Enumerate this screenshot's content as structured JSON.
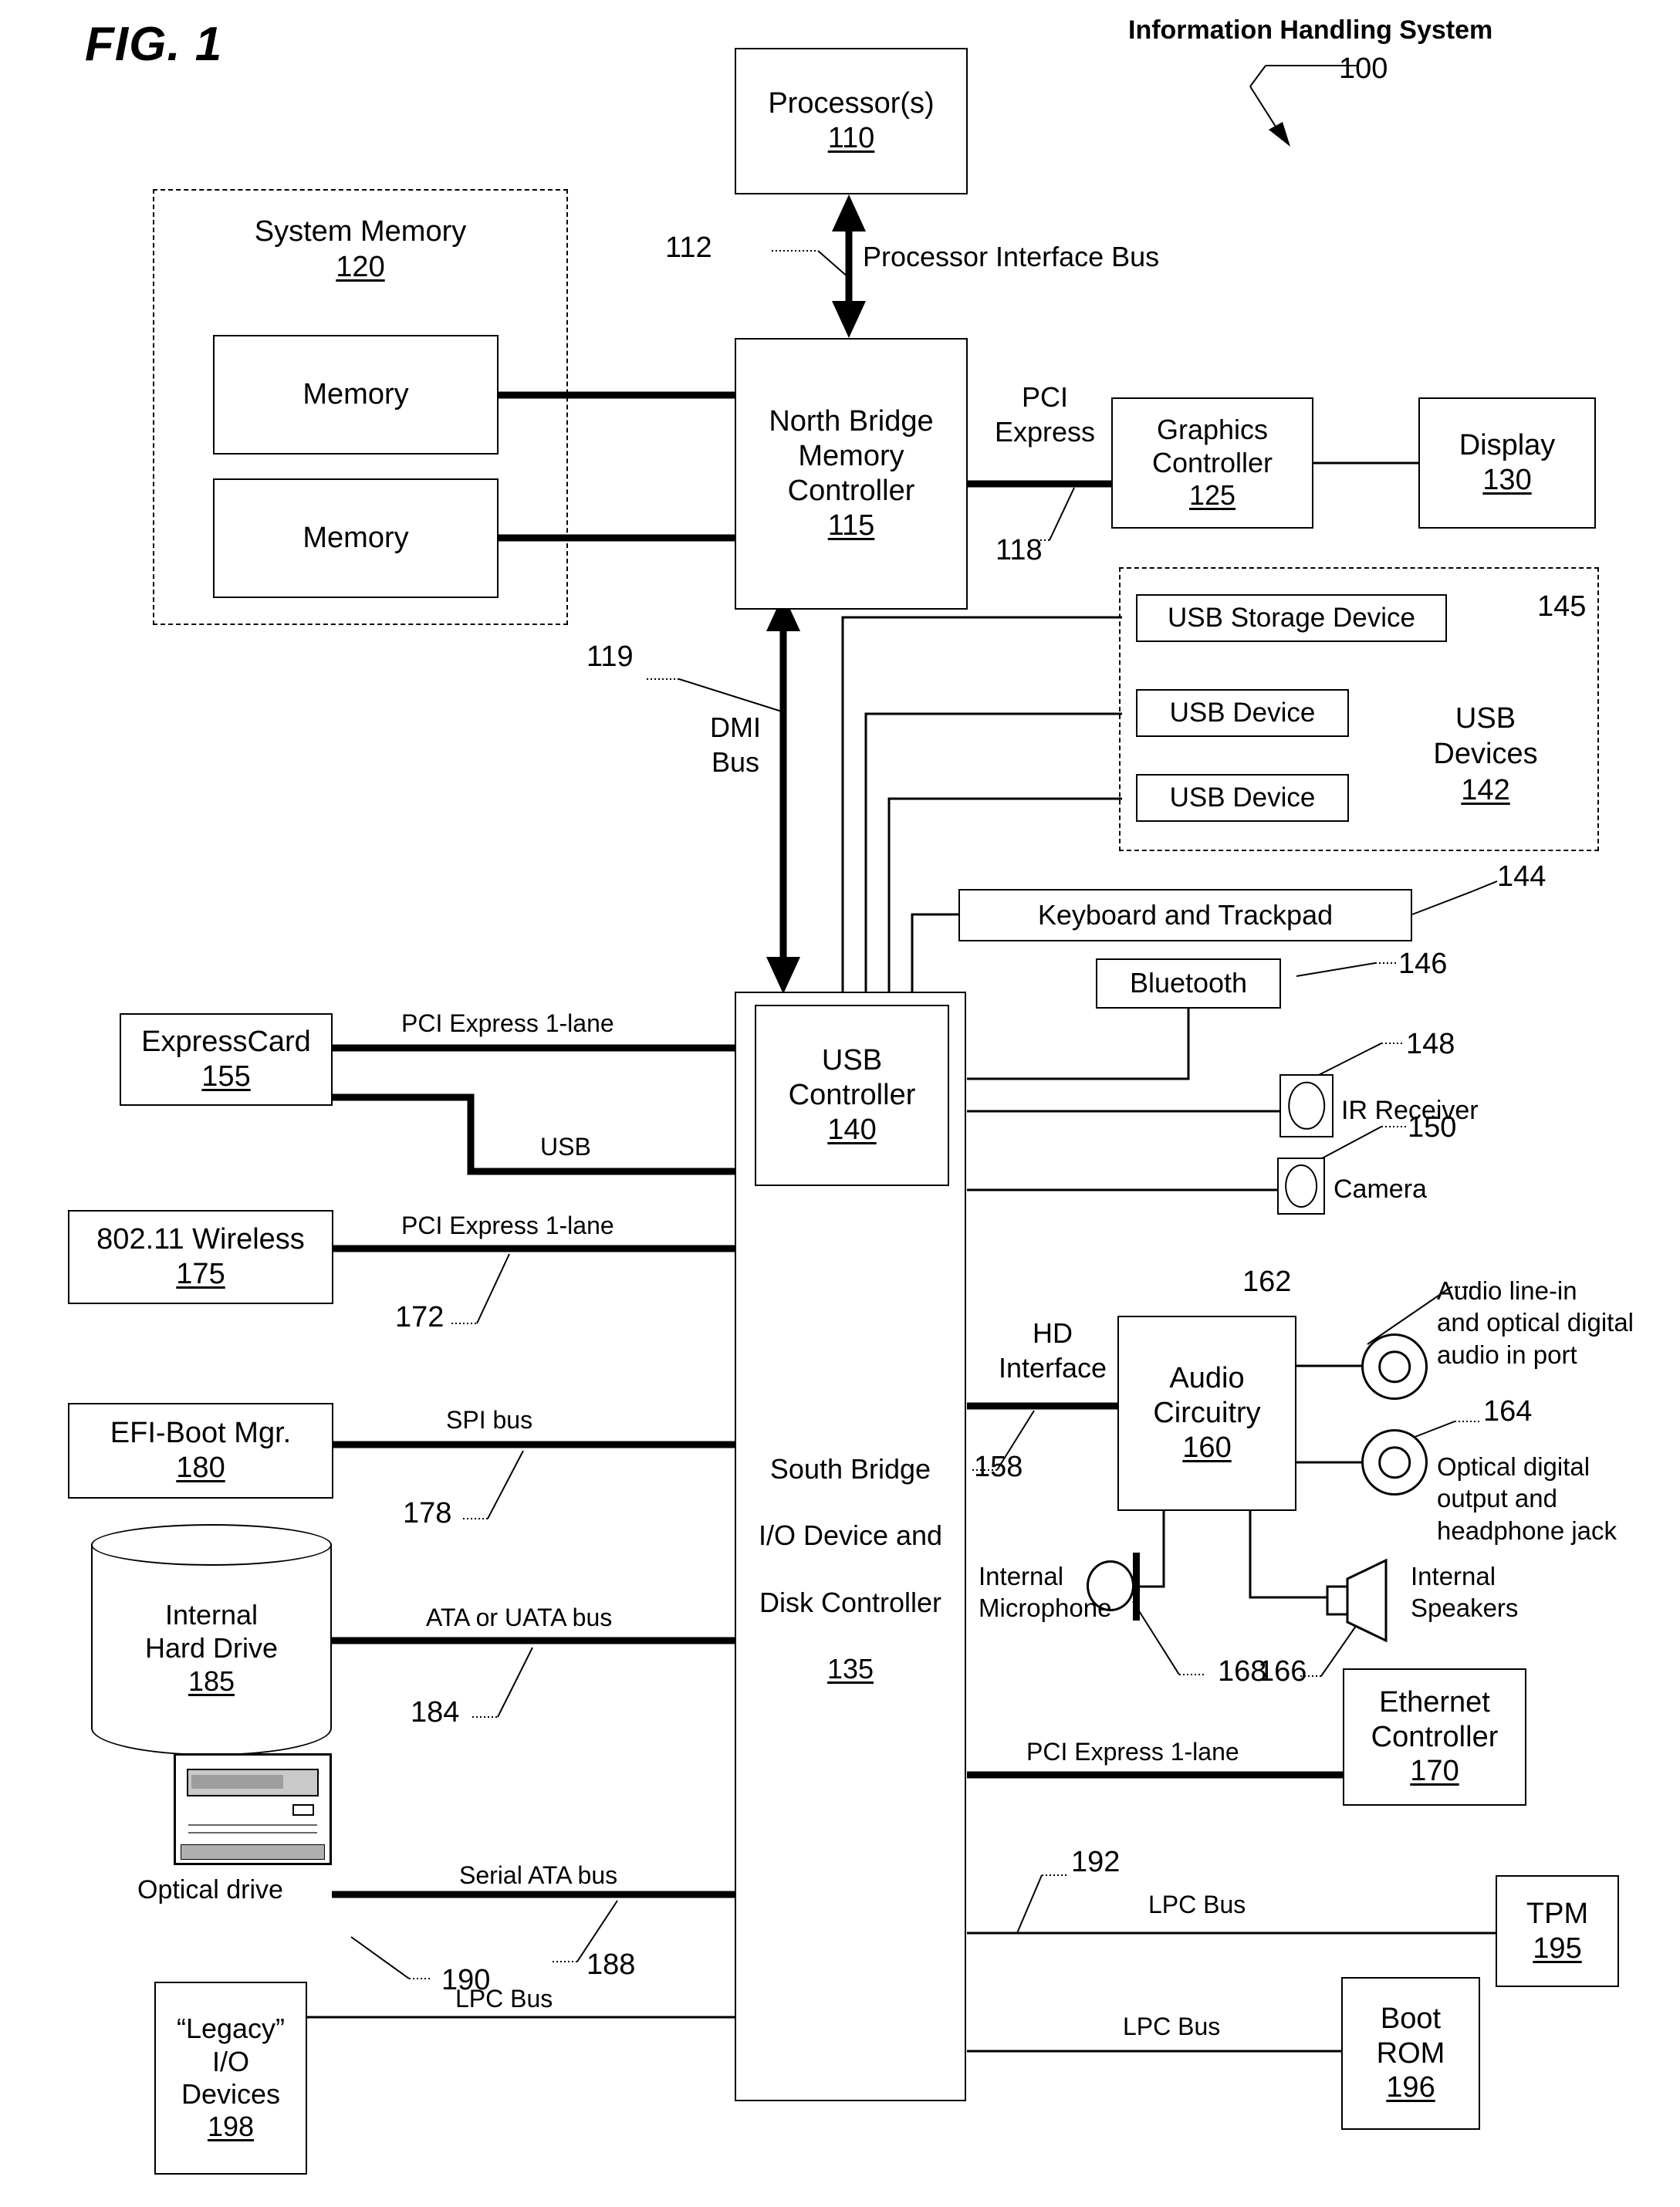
{
  "figure": {
    "title": "FIG. 1",
    "system_title": "Information Handling System",
    "system_ref": "100"
  },
  "blocks": {
    "processor": {
      "lines": [
        "Processor(s)"
      ],
      "num": "110"
    },
    "system_memory": {
      "lines": [
        "System Memory"
      ],
      "num": "120"
    },
    "memory_1": {
      "lines": [
        "Memory"
      ],
      "num": ""
    },
    "memory_2": {
      "lines": [
        "Memory"
      ],
      "num": ""
    },
    "north_bridge": {
      "lines": [
        "North Bridge",
        "Memory",
        "Controller"
      ],
      "num": "115"
    },
    "graphics": {
      "lines": [
        "Graphics",
        "Controller"
      ],
      "num": "125"
    },
    "display": {
      "lines": [
        "Display"
      ],
      "num": "130"
    },
    "usb_devices": {
      "lines": [
        "USB",
        "Devices"
      ],
      "num": "142"
    },
    "usb_storage": {
      "lines": [
        "USB Storage Device"
      ],
      "num": ""
    },
    "usb_device_1": {
      "lines": [
        "USB Device"
      ],
      "num": ""
    },
    "usb_device_2": {
      "lines": [
        "USB Device"
      ],
      "num": ""
    },
    "keyboard": {
      "lines": [
        "Keyboard and Trackpad"
      ],
      "num": ""
    },
    "bluetooth": {
      "lines": [
        "Bluetooth"
      ],
      "num": ""
    },
    "usb_controller": {
      "lines": [
        "USB",
        "Controller"
      ],
      "num": "140"
    },
    "south_bridge": {
      "lines": [
        "South Bridge",
        "I/O Device and",
        "Disk Controller"
      ],
      "num": "135"
    },
    "expresscard": {
      "lines": [
        "ExpressCard"
      ],
      "num": "155"
    },
    "wireless": {
      "lines": [
        "802.11 Wireless"
      ],
      "num": "175"
    },
    "efi_boot": {
      "lines": [
        "EFI-Boot Mgr."
      ],
      "num": "180"
    },
    "hard_drive": {
      "lines": [
        "Internal",
        "Hard Drive"
      ],
      "num": "185"
    },
    "audio": {
      "lines": [
        "Audio",
        "Circuitry"
      ],
      "num": "160"
    },
    "ethernet": {
      "lines": [
        "Ethernet",
        "Controller"
      ],
      "num": "170"
    },
    "tpm": {
      "lines": [
        "TPM"
      ],
      "num": "195"
    },
    "boot_rom": {
      "lines": [
        "Boot",
        "ROM"
      ],
      "num": "196"
    },
    "legacy_io": {
      "lines": [
        "“Legacy”",
        "I/O",
        "Devices"
      ],
      "num": "198"
    }
  },
  "bus_labels": {
    "processor_interface_bus": "Processor Interface Bus",
    "pci_express": "PCI\nExpress",
    "dmi_bus": "DMI\nBus",
    "pcie_1lane_expresscard": "PCI Express 1-lane",
    "usb": "USB",
    "pcie_1lane_wireless": "PCI Express 1-lane",
    "spi_bus": "SPI bus",
    "ata_uata_bus": "ATA or UATA bus",
    "serial_ata_bus": "Serial ATA bus",
    "hd_interface": "HD\nInterface",
    "pcie_1lane_ethernet": "PCI Express 1-lane",
    "lpc_bus_tpm": "LPC Bus",
    "lpc_bus_bootrom": "LPC Bus",
    "lpc_bus_legacy": "LPC Bus"
  },
  "device_labels": {
    "ir_receiver": "IR Receiver",
    "camera": "Camera",
    "internal_microphone": "Internal\nMicrophone",
    "internal_speakers": "Internal\nSpeakers",
    "optical_drive": "Optical drive",
    "audio_line_in": "Audio line-in\nand optical digital\naudio in port",
    "optical_out": "Optical digital\noutput and\nheadphone jack"
  },
  "reference_numerals": {
    "n100": "100",
    "n112": "112",
    "n118": "118",
    "n119": "119",
    "n144": "144",
    "n145": "145",
    "n146": "146",
    "n148": "148",
    "n150": "150",
    "n158": "158",
    "n162": "162",
    "n164": "164",
    "n166": "166",
    "n168": "168",
    "n172": "172",
    "n178": "178",
    "n184": "184",
    "n188": "188",
    "n190": "190",
    "n192": "192"
  }
}
